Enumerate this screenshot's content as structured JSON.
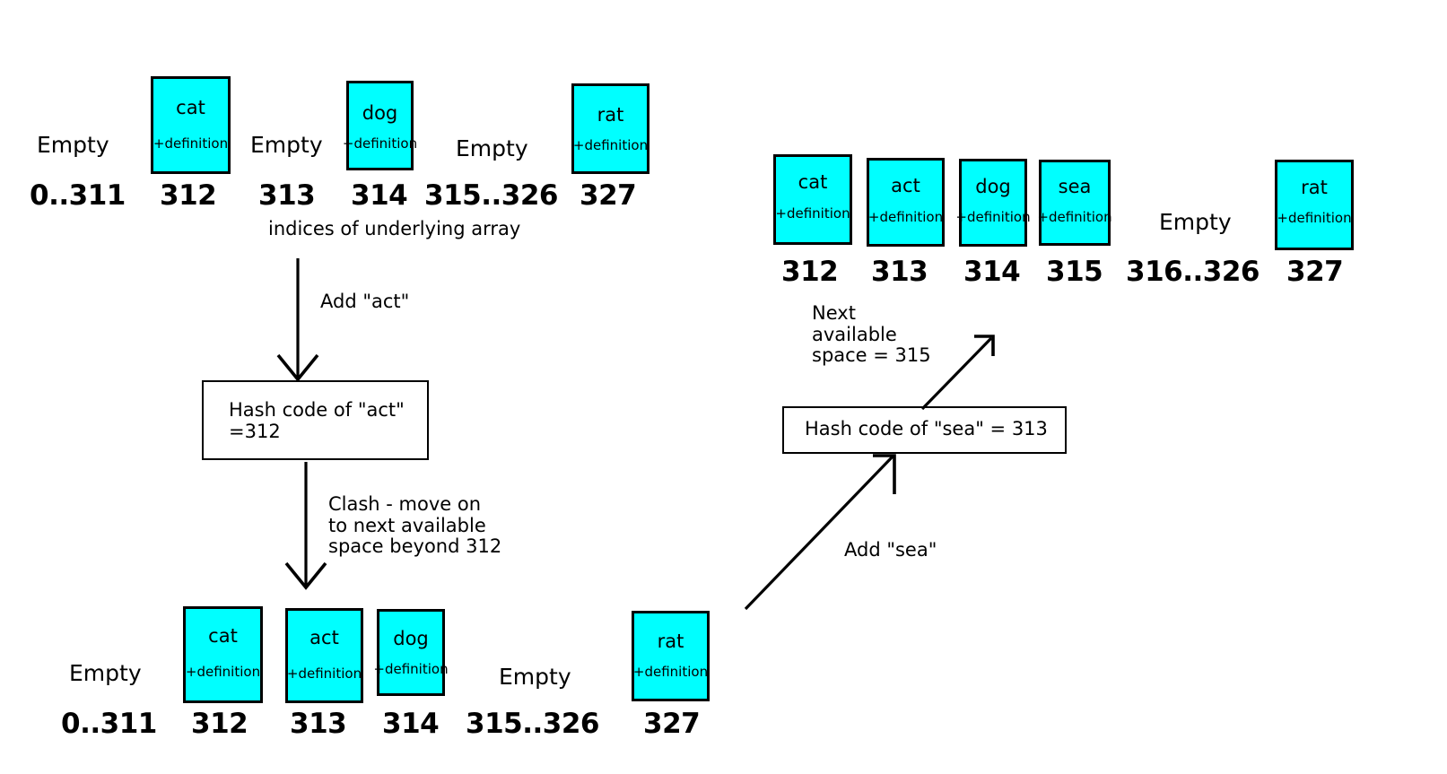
{
  "diagram": {
    "title": "Hash table open addressing / linear probing illustration",
    "box_fill_color": "#00FFFF",
    "box_border_color": "#000000",
    "definition_text": "+definition",
    "empty_text": "Empty",
    "caption_indices": "indices of underlying array"
  },
  "arrays": {
    "top_left": {
      "slots": [
        {
          "label": "Empty",
          "kind": "empty",
          "index": "0..311"
        },
        {
          "label": "cat",
          "kind": "filled",
          "index": "312",
          "defn": "+definition"
        },
        {
          "label": "Empty",
          "kind": "empty",
          "index": "313"
        },
        {
          "label": "dog",
          "kind": "filled",
          "index": "314",
          "defn": "+definition"
        },
        {
          "label": "Empty",
          "kind": "empty",
          "index": "315..326"
        },
        {
          "label": "rat",
          "kind": "filled",
          "index": "327",
          "defn": "+definition"
        }
      ]
    },
    "bottom_left": {
      "slots": [
        {
          "label": "Empty",
          "kind": "empty",
          "index": "0..311"
        },
        {
          "label": "cat",
          "kind": "filled",
          "index": "312",
          "defn": "+definition"
        },
        {
          "label": "act",
          "kind": "filled",
          "index": "313",
          "defn": "+definition"
        },
        {
          "label": "dog",
          "kind": "filled",
          "index": "314",
          "defn": "+definition"
        },
        {
          "label": "Empty",
          "kind": "empty",
          "index": "315..326"
        },
        {
          "label": "rat",
          "kind": "filled",
          "index": "327",
          "defn": "+definition"
        }
      ]
    },
    "right": {
      "slots": [
        {
          "label": "cat",
          "kind": "filled",
          "index": "312",
          "defn": "+definition"
        },
        {
          "label": "act",
          "kind": "filled",
          "index": "313",
          "defn": "+definition"
        },
        {
          "label": "dog",
          "kind": "filled",
          "index": "314",
          "defn": "+definition"
        },
        {
          "label": "sea",
          "kind": "filled",
          "index": "315",
          "defn": "+definition"
        },
        {
          "label": "Empty",
          "kind": "empty",
          "index": "316..326"
        },
        {
          "label": "rat",
          "kind": "filled",
          "index": "327",
          "defn": "+definition"
        }
      ]
    }
  },
  "annotations": {
    "add_act": "Add \"act\"",
    "hash_act": "Hash code of \"act\"\n=312",
    "clash": "Clash - move on\nto next available\nspace beyond 312",
    "add_sea": "Add \"sea\"",
    "hash_sea": "Hash code of \"sea\" = 313",
    "next_available": "Next\navailable\nspace = 315"
  }
}
